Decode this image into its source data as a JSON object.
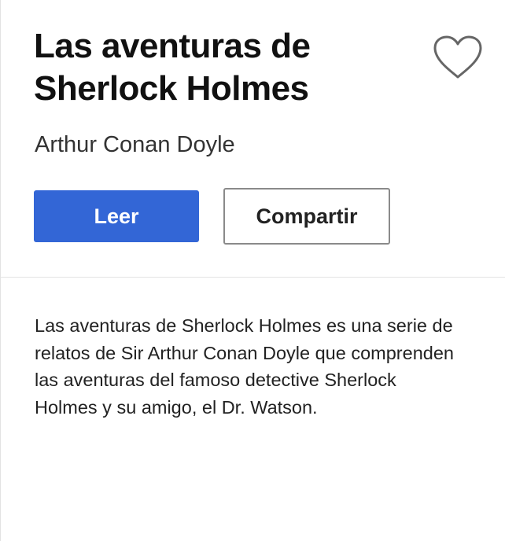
{
  "book": {
    "title": "Las aventuras de Sherlock Holmes",
    "author": "Arthur Conan Doyle",
    "description": "Las aventuras de Sherlock Holmes es una serie de relatos de Sir Arthur Conan Doyle que comprenden las aventuras del famoso detective Sherlock Holmes y su amigo, el Dr. Watson."
  },
  "actions": {
    "read_label": "Leer",
    "share_label": "Compartir",
    "favorite_icon": "heart-outline-icon"
  },
  "colors": {
    "primary_button": "#3366d6",
    "icon_stroke": "#666666",
    "divider": "#e3e3e3"
  }
}
